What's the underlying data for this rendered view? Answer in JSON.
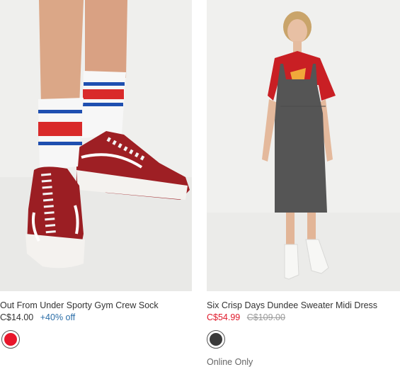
{
  "products": [
    {
      "name": "Out From Under Sporty Gym Crew Sock",
      "price": "C$14.00",
      "badge": "+40% off",
      "swatch_color": "#e8162b",
      "photo_alt": "red-sneakers-striped-socks-photo"
    },
    {
      "name": "Six Crisp Days Dundee Sweater Midi Dress",
      "price": "C$54.99",
      "original_price": "C$109.00",
      "swatch_color": "#3a3a3a",
      "note": "Online Only",
      "photo_alt": "grey-midi-dress-photo"
    }
  ],
  "colors": {
    "sale_red": "#e0192a",
    "badge_blue": "#2b6ea8",
    "strike_grey": "#9b9b9b"
  }
}
